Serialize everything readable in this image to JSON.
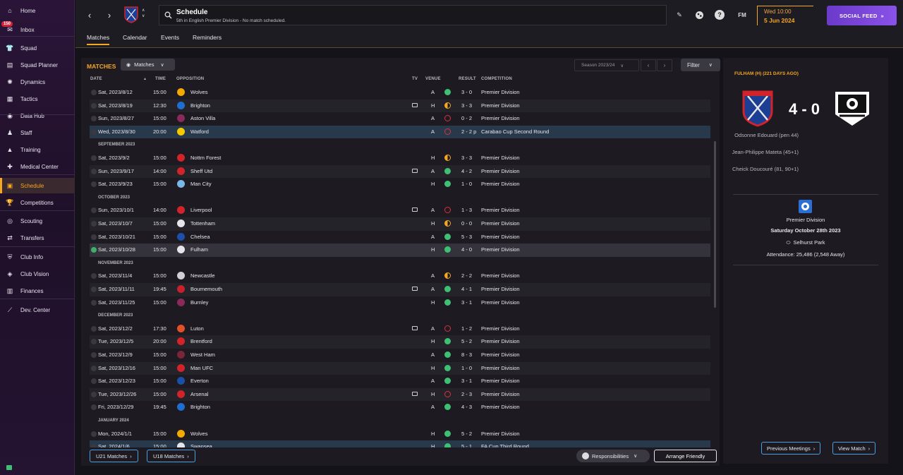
{
  "sidebar": {
    "inbox_badge": "150",
    "items": [
      {
        "label": "Home",
        "icon": "home-icon"
      },
      {
        "label": "Inbox",
        "icon": "inbox-icon"
      },
      {
        "label": "Squad",
        "icon": "shirt-icon"
      },
      {
        "label": "Squad Planner",
        "icon": "planner-icon"
      },
      {
        "label": "Dynamics",
        "icon": "dynamics-icon"
      },
      {
        "label": "Tactics",
        "icon": "tactics-icon"
      },
      {
        "label": "Data Hub",
        "icon": "data-hub-icon"
      },
      {
        "label": "Staff",
        "icon": "staff-icon"
      },
      {
        "label": "Training",
        "icon": "training-icon"
      },
      {
        "label": "Medical Center",
        "icon": "medical-icon"
      },
      {
        "label": "Schedule",
        "icon": "calendar-icon"
      },
      {
        "label": "Competitions",
        "icon": "trophy-icon"
      },
      {
        "label": "Scouting",
        "icon": "scouting-icon"
      },
      {
        "label": "Transfers",
        "icon": "transfers-icon"
      },
      {
        "label": "Club Info",
        "icon": "shield-icon"
      },
      {
        "label": "Club Vision",
        "icon": "vision-icon"
      },
      {
        "label": "Finances",
        "icon": "finances-icon"
      },
      {
        "label": "Dev. Center",
        "icon": "dev-center-icon"
      }
    ]
  },
  "header": {
    "title": "Schedule",
    "subtitle": "5th in English Premier Division - No match scheduled.",
    "fm_label": "FM",
    "date_line1": "Wed 10:00",
    "date_line2": "5 Jun 2024",
    "social_feed": "SOCIAL FEED"
  },
  "tabs": [
    "Matches",
    "Calendar",
    "Events",
    "Reminders"
  ],
  "main": {
    "title": "MATCHES",
    "dropdown": "Matches",
    "season": "Season 2023/24",
    "filter": "Filter",
    "columns": [
      "DATE",
      "TIME",
      "OPPOSITION",
      "TV",
      "VENUE",
      "RESULT",
      "COMPETITION"
    ],
    "rows": [
      {
        "type": "match",
        "date": "Sat, 2023/8/12",
        "time": "15:00",
        "opp": "Wolves",
        "tv": false,
        "venue": "A",
        "res": "W",
        "score": "3 - 0",
        "comp": "Premier Division",
        "crest": "#f2a900"
      },
      {
        "type": "match",
        "date": "Sat, 2023/8/19",
        "time": "12:30",
        "opp": "Brighton",
        "tv": true,
        "venue": "H",
        "res": "D",
        "score": "3 - 3",
        "comp": "Premier Division",
        "crest": "#1e6fd0"
      },
      {
        "type": "match",
        "date": "Sun, 2023/8/27",
        "time": "15:00",
        "opp": "Aston Villa",
        "tv": false,
        "venue": "A",
        "res": "L",
        "score": "0 - 2",
        "comp": "Premier Division",
        "crest": "#8a2a5a"
      },
      {
        "type": "match",
        "date": "Wed, 2023/8/30",
        "time": "20:00",
        "opp": "Watford",
        "tv": false,
        "venue": "A",
        "res": "L",
        "score": "2 - 2 p",
        "comp": "Carabao Cup Second Round",
        "crest": "#f5c800"
      },
      {
        "type": "month",
        "label": "SEPTEMBER 2023"
      },
      {
        "type": "match",
        "date": "Sat, 2023/9/2",
        "time": "15:00",
        "opp": "Nottm Forest",
        "tv": false,
        "venue": "H",
        "res": "D",
        "score": "3 - 3",
        "comp": "Premier Division",
        "crest": "#d2232a"
      },
      {
        "type": "match",
        "date": "Sun, 2023/9/17",
        "time": "14:00",
        "opp": "Sheff Utd",
        "tv": true,
        "venue": "A",
        "res": "W",
        "score": "4 - 2",
        "comp": "Premier Division",
        "crest": "#d2232a"
      },
      {
        "type": "match",
        "date": "Sat, 2023/9/23",
        "time": "15:00",
        "opp": "Man City",
        "tv": false,
        "venue": "H",
        "res": "W",
        "score": "1 - 0",
        "comp": "Premier Division",
        "crest": "#7ab6e8"
      },
      {
        "type": "month",
        "label": "OCTOBER 2023"
      },
      {
        "type": "match",
        "date": "Sun, 2023/10/1",
        "time": "14:00",
        "opp": "Liverpool",
        "tv": true,
        "venue": "A",
        "res": "L",
        "score": "1 - 3",
        "comp": "Premier Division",
        "crest": "#d2232a"
      },
      {
        "type": "match",
        "date": "Sat, 2023/10/7",
        "time": "15:00",
        "opp": "Tottenham",
        "tv": false,
        "venue": "H",
        "res": "D",
        "score": "0 - 0",
        "comp": "Premier Division",
        "crest": "#e6e6ea"
      },
      {
        "type": "match",
        "date": "Sat, 2023/10/21",
        "time": "15:00",
        "opp": "Chelsea",
        "tv": false,
        "venue": "A",
        "res": "W",
        "score": "5 - 3",
        "comp": "Premier Division",
        "crest": "#1c4fa8"
      },
      {
        "type": "match",
        "date": "Sat, 2023/10/28",
        "time": "15:00",
        "opp": "Fulham",
        "tv": false,
        "venue": "H",
        "res": "W",
        "score": "4 - 0",
        "comp": "Premier Division",
        "crest": "#e6e6ea",
        "played": true,
        "highlight": "fulham"
      },
      {
        "type": "month",
        "label": "NOVEMBER 2023"
      },
      {
        "type": "match",
        "date": "Sat, 2023/11/4",
        "time": "15:00",
        "opp": "Newcastle",
        "tv": false,
        "venue": "A",
        "res": "D",
        "score": "2 - 2",
        "comp": "Premier Division",
        "crest": "#cfcfd4"
      },
      {
        "type": "match",
        "date": "Sat, 2023/11/11",
        "time": "19:45",
        "opp": "Bournemouth",
        "tv": true,
        "venue": "A",
        "res": "W",
        "score": "4 - 1",
        "comp": "Premier Division",
        "crest": "#c8202f"
      },
      {
        "type": "match",
        "date": "Sat, 2023/11/25",
        "time": "15:00",
        "opp": "Burnley",
        "tv": false,
        "venue": "H",
        "res": "W",
        "score": "3 - 1",
        "comp": "Premier Division",
        "crest": "#8a2a5a"
      },
      {
        "type": "month",
        "label": "DECEMBER 2023"
      },
      {
        "type": "match",
        "date": "Sat, 2023/12/2",
        "time": "17:30",
        "opp": "Luton",
        "tv": true,
        "venue": "A",
        "res": "L",
        "score": "1 - 2",
        "comp": "Premier Division",
        "crest": "#e0502a"
      },
      {
        "type": "match",
        "date": "Tue, 2023/12/5",
        "time": "20:00",
        "opp": "Brentford",
        "tv": false,
        "venue": "H",
        "res": "W",
        "score": "5 - 2",
        "comp": "Premier Division",
        "crest": "#d2232a"
      },
      {
        "type": "match",
        "date": "Sat, 2023/12/9",
        "time": "15:00",
        "opp": "West Ham",
        "tv": false,
        "venue": "A",
        "res": "W",
        "score": "8 - 3",
        "comp": "Premier Division",
        "crest": "#7a263a"
      },
      {
        "type": "match",
        "date": "Sat, 2023/12/16",
        "time": "15:00",
        "opp": "Man UFC",
        "tv": false,
        "venue": "H",
        "res": "W",
        "score": "1 - 0",
        "comp": "Premier Division",
        "crest": "#d2232a"
      },
      {
        "type": "match",
        "date": "Sat, 2023/12/23",
        "time": "15:00",
        "opp": "Everton",
        "tv": false,
        "venue": "A",
        "res": "W",
        "score": "3 - 1",
        "comp": "Premier Division",
        "crest": "#1c4fa8"
      },
      {
        "type": "match",
        "date": "Tue, 2023/12/26",
        "time": "15:00",
        "opp": "Arsenal",
        "tv": true,
        "venue": "H",
        "res": "L",
        "score": "2 - 3",
        "comp": "Premier Division",
        "crest": "#d2232a"
      },
      {
        "type": "match",
        "date": "Fri, 2023/12/29",
        "time": "19:45",
        "opp": "Brighton",
        "tv": false,
        "venue": "A",
        "res": "W",
        "score": "4 - 3",
        "comp": "Premier Division",
        "crest": "#1e6fd0"
      },
      {
        "type": "month",
        "label": "JANUARY 2024"
      },
      {
        "type": "match",
        "date": "Mon, 2024/1/1",
        "time": "15:00",
        "opp": "Wolves",
        "tv": false,
        "venue": "H",
        "res": "W",
        "score": "5 - 2",
        "comp": "Premier Division",
        "crest": "#f2a900"
      },
      {
        "type": "match",
        "date": "Sat, 2024/1/6",
        "time": "15:00",
        "opp": "Swansea",
        "tv": false,
        "venue": "H",
        "res": "W",
        "score": "5 - 1",
        "comp": "FA Cup Third Round",
        "crest": "#e6e6ea",
        "highlight": "sel"
      }
    ],
    "u21": "U21 Matches",
    "u18": "U18 Matches",
    "responsibilities": "Responsibilities",
    "arrange_friendly": "Arrange Friendly"
  },
  "side": {
    "title": "FULHAM (H) (221 DAYS AGO)",
    "score": "4 - 0",
    "scorers": [
      "Odsonne Edouard (pen 44)",
      "Jean-Philippe Mateta (45+1)",
      "Cheick Doucouré (81, 90+1)"
    ],
    "competition": "Premier Division",
    "date": "Saturday October 28th 2023",
    "stadium": "Selhurst Park",
    "attendance": "Attendance: 25,486 (2,548 Away)",
    "prev": "Previous Meetings",
    "view": "View Match"
  },
  "colors": {
    "accent": "#f5a623",
    "win": "#3fbf74",
    "loss": "#d9323c",
    "draw": "#f5a623",
    "social": "#7b45d8"
  }
}
